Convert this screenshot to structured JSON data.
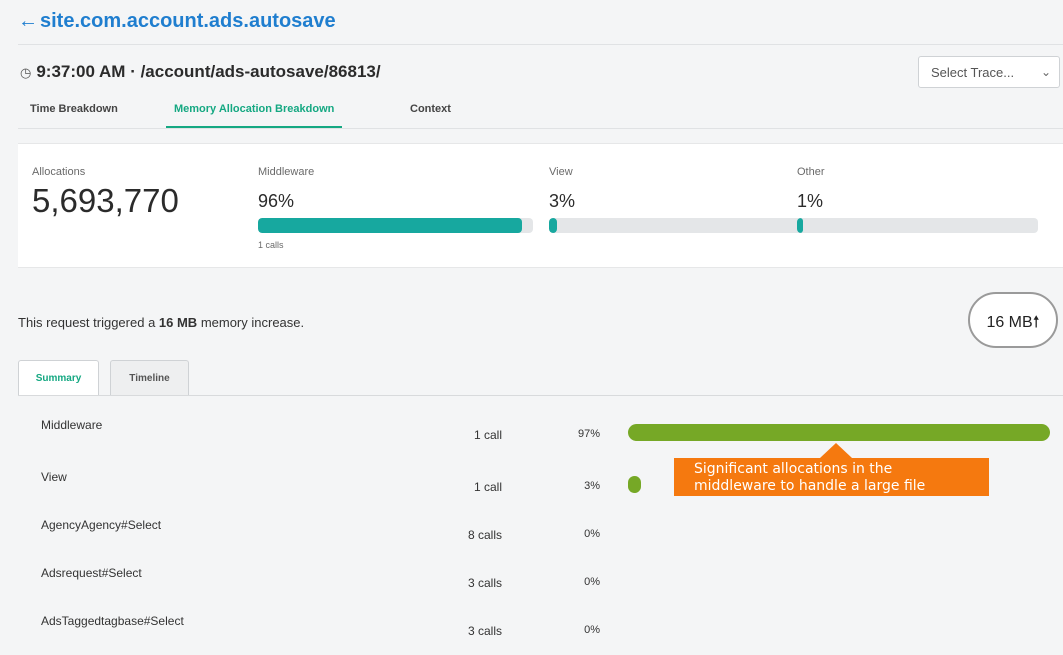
{
  "header": {
    "back_arrow": "←",
    "back_label": "site.com.account.ads.autosave",
    "clock_icon": "clock-icon",
    "trace_title": "9:37:00 AM · /account/ads-autosave/86813/",
    "select_trace": "Select Trace...",
    "select_chevron": "⌄"
  },
  "tabs": {
    "time": "Time Breakdown",
    "memory": "Memory Allocation Breakdown",
    "context": "Context",
    "active": "memory"
  },
  "allocations": {
    "label": "Allocations",
    "total": "5,693,770",
    "bar_color": "#17a89f",
    "metrics": [
      {
        "label": "Middleware",
        "value": "96%",
        "fraction": 0.96,
        "sub": "1 calls"
      },
      {
        "label": "View",
        "value": "3%",
        "fraction": 0.03
      },
      {
        "label": "Other",
        "value": "1%",
        "fraction": 0.01
      }
    ]
  },
  "increase": {
    "prefix": "This request triggered a ",
    "amount": "16 MB",
    "suffix": " memory increase.",
    "badge": "16 MB",
    "badge_icon": "arrow-up-icon"
  },
  "subtabs": {
    "summary": "Summary",
    "timeline": "Timeline",
    "active": "summary"
  },
  "rows": [
    {
      "name": "Middleware",
      "calls": "1 call",
      "pct": "97%",
      "fraction": 0.97
    },
    {
      "name": "View",
      "calls": "1 call",
      "pct": "3%",
      "fraction": 0.03
    },
    {
      "name": "AgencyAgency#Select",
      "calls": "8 calls",
      "pct": "0%",
      "fraction": 0
    },
    {
      "name": "Adsrequest#Select",
      "calls": "3 calls",
      "pct": "0%",
      "fraction": 0
    },
    {
      "name": "AdsTaggedtagbase#Select",
      "calls": "3 calls",
      "pct": "0%",
      "fraction": 0
    }
  ],
  "row_bar_color": "#76a826",
  "callout": {
    "line1": "Significant allocations in the",
    "line2": "middleware to handle a large file",
    "color": "#f5790f"
  },
  "colors": {
    "link": "#1f7ecf",
    "accent": "#15a882"
  }
}
